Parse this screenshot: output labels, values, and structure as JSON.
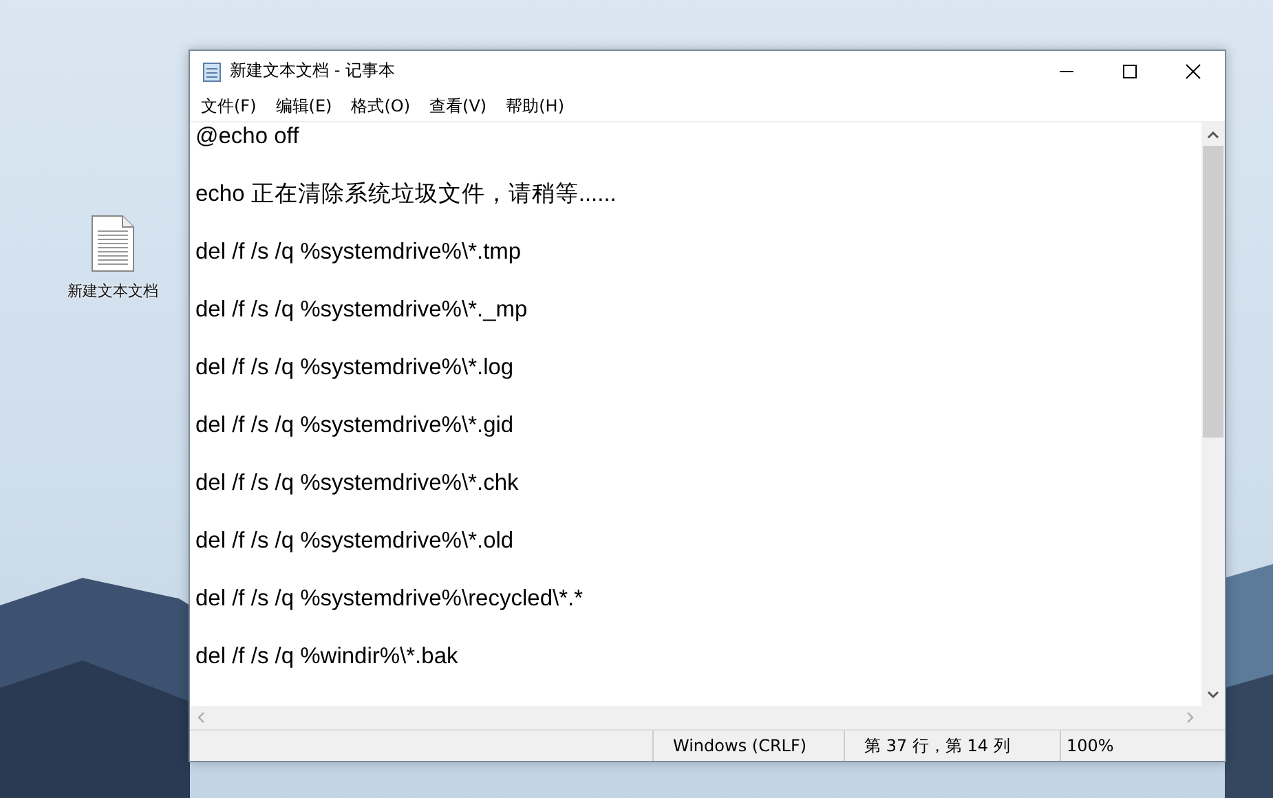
{
  "desktop_icons": [
    {
      "label": "新建文本文档"
    }
  ],
  "window": {
    "title": "新建文本文档 - 记事本"
  },
  "menu": [
    "文件(F)",
    "编辑(E)",
    "格式(O)",
    "查看(V)",
    "帮助(H)"
  ],
  "lines": [
    "@echo off",
    "echo 正在清除系统垃圾文件，请稍等......",
    "del /f /s /q %systemdrive%\\*.tmp",
    "del /f /s /q %systemdrive%\\*._mp",
    "del /f /s /q %systemdrive%\\*.log",
    "del /f /s /q %systemdrive%\\*.gid",
    "del /f /s /q %systemdrive%\\*.chk",
    "del /f /s /q %systemdrive%\\*.old",
    "del /f /s /q %systemdrive%\\recycled\\*.*",
    "del /f /s /q %windir%\\*.bak"
  ],
  "status_bar": {
    "line_ending": "Windows (CRLF)",
    "position": "第 37 行，第 14 列",
    "zoom": "100%"
  }
}
